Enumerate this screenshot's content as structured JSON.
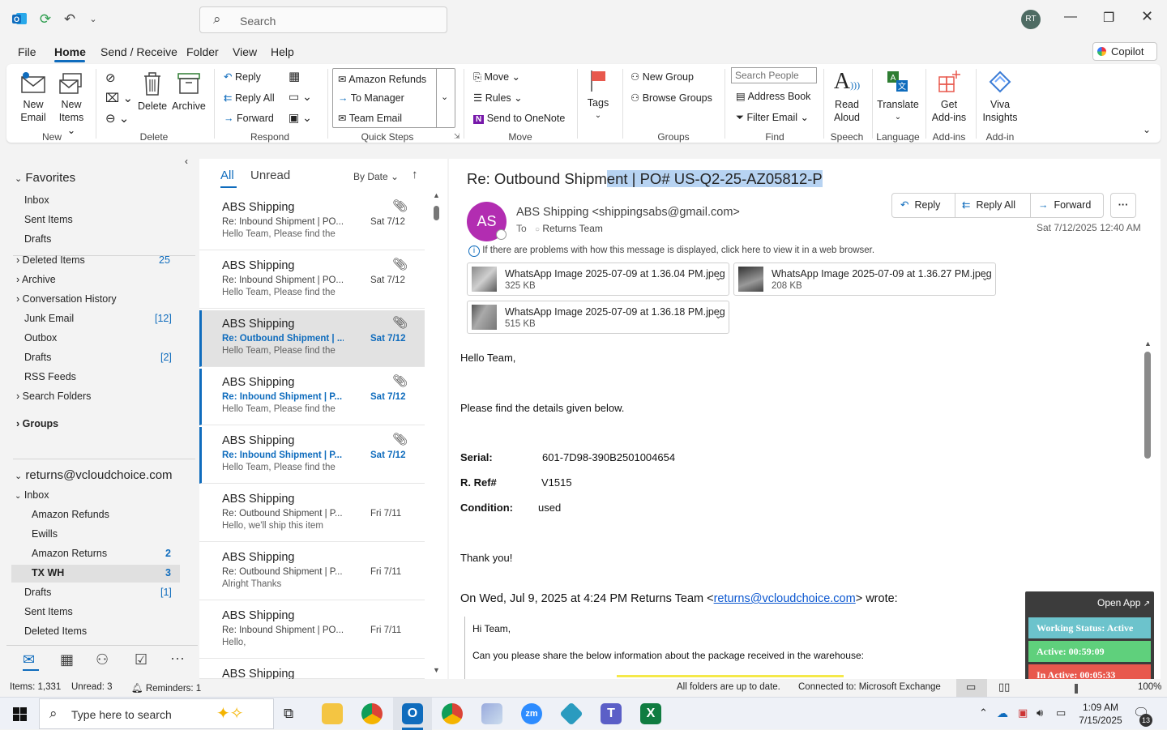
{
  "titlebar": {
    "search_placeholder": "Search",
    "avatar_initials": "RT"
  },
  "menu": {
    "file": "File",
    "home": "Home",
    "send_receive": "Send / Receive",
    "folder": "Folder",
    "view": "View",
    "help": "Help",
    "copilot": "Copilot"
  },
  "ribbon": {
    "new_email": "New Email",
    "new_items": "New Items",
    "group_new": "New",
    "delete": "Delete",
    "archive": "Archive",
    "group_delete": "Delete",
    "reply": "Reply",
    "reply_all": "Reply All",
    "forward": "Forward",
    "group_respond": "Respond",
    "qs_amazon_refunds": "Amazon Refunds",
    "qs_to_manager": "To Manager",
    "qs_team_email": "Team Email",
    "group_quick_steps": "Quick Steps",
    "move": "Move",
    "rules": "Rules",
    "send_to_onenote": "Send to OneNote",
    "group_move": "Move",
    "tags": "Tags",
    "new_group": "New Group",
    "browse_groups": "Browse Groups",
    "group_groups": "Groups",
    "search_people_placeholder": "Search People",
    "address_book": "Address Book",
    "filter_email": "Filter Email",
    "group_find": "Find",
    "read_aloud": "Read Aloud",
    "group_speech": "Speech",
    "translate": "Translate",
    "group_language": "Language",
    "get_addins": "Get Add-ins",
    "group_addins": "Add-ins",
    "viva_insights": "Viva Insights",
    "group_addin": "Add-in"
  },
  "nav": {
    "favorites": "Favorites",
    "fav_inbox": "Inbox",
    "fav_sent": "Sent Items",
    "fav_drafts": "Drafts",
    "deleted_items": "Deleted Items",
    "deleted_count": "25",
    "archive": "Archive",
    "conversation_history": "Conversation History",
    "junk_email": "Junk Email",
    "junk_count": "[12]",
    "outbox": "Outbox",
    "drafts": "Drafts",
    "drafts_count": "[2]",
    "rss_feeds": "RSS Feeds",
    "search_folders": "Search Folders",
    "groups": "Groups",
    "account": "returns@vcloudchoice.com",
    "inbox": "Inbox",
    "amazon_refunds": "Amazon Refunds",
    "ewills": "Ewills",
    "amazon_returns": "Amazon Returns",
    "amazon_returns_count": "2",
    "tx_wh": "TX WH",
    "tx_wh_count": "3",
    "acct_drafts": "Drafts",
    "acct_drafts_count": "[1]",
    "acct_sent": "Sent Items",
    "acct_deleted": "Deleted Items"
  },
  "list": {
    "tab_all": "All",
    "tab_unread": "Unread",
    "sort": "By Date",
    "items": [
      {
        "from": "ABS Shipping",
        "subject": "Re: Inbound Shipment | PO...",
        "preview": "Hello Team,  Please find the",
        "date": "Sat 7/12"
      },
      {
        "from": "ABS Shipping",
        "subject": "Re: Inbound Shipment | PO...",
        "preview": "Hello Team,  Please find the",
        "date": "Sat 7/12"
      },
      {
        "from": "ABS Shipping",
        "subject": "Re: Outbound Shipment | ...",
        "preview": "Hello Team,  Please find the",
        "date": "Sat 7/12"
      },
      {
        "from": "ABS Shipping",
        "subject": "Re: Inbound Shipment | P...",
        "preview": "Hello Team,  Please find the",
        "date": "Sat 7/12"
      },
      {
        "from": "ABS Shipping",
        "subject": "Re: Inbound Shipment | P...",
        "preview": "Hello Team,  Please find the",
        "date": "Sat 7/12"
      },
      {
        "from": "ABS Shipping",
        "subject": "Re: Outbound Shipment | P...",
        "preview": "Hello,  we'll ship this item",
        "date": "Fri 7/11"
      },
      {
        "from": "ABS Shipping",
        "subject": "Re: Outbound Shipment | P...",
        "preview": "Alright  Thanks",
        "date": "Fri 7/11"
      },
      {
        "from": "ABS Shipping",
        "subject": "Re: Inbound Shipment | PO...",
        "preview": "Hello,",
        "date": "Fri 7/11"
      },
      {
        "from": "ABS Shipping",
        "subject": "",
        "preview": "",
        "date": ""
      }
    ]
  },
  "message": {
    "subject_plain": "Re: Outbound Shipm",
    "subject_selected": "ent | PO# US-Q2-25-AZ05812-P",
    "sender_initials": "AS",
    "sender": "ABS Shipping <shippingsabs@gmail.com>",
    "to_label": "To",
    "to": "Returns Team",
    "date": "Sat 7/12/2025 12:40 AM",
    "reply": "Reply",
    "reply_all": "Reply All",
    "forward": "Forward",
    "info_bar": "If there are problems with how this message is displayed, click here to view it in a web browser.",
    "attachments": [
      {
        "name": "WhatsApp Image 2025-07-09 at 1.36.04 PM.jpeg",
        "size": "325 KB"
      },
      {
        "name": "WhatsApp Image 2025-07-09 at 1.36.27 PM.jpeg",
        "size": "208 KB"
      },
      {
        "name": "WhatsApp Image 2025-07-09 at 1.36.18 PM.jpeg",
        "size": "515 KB"
      }
    ],
    "greeting": "Hello Team,",
    "intro": "Please find the details given below.",
    "serial_label": "Serial:",
    "serial_value": "601-7D98-390B2501004654",
    "ref_label": "R. Ref#",
    "ref_value": "V1515",
    "condition_label": "Condition:",
    "condition_value": "used",
    "thanks": "Thank you!",
    "quote_prefix": "On Wed, Jul 9, 2025 at 4:24 PM Returns Team <",
    "quote_email": "returns@vcloudchoice.com",
    "quote_suffix": "> wrote:",
    "quote_hi": "Hi Team,",
    "quote_body": "Can you please share the below information about the package received in the warehouse:"
  },
  "widget": {
    "open_app": "Open App",
    "working_status": "Working Status: Active",
    "active": "Active: 00:59:09",
    "inactive": "In Active: 00:05:33",
    "colors": {
      "status": "#6cc3cc",
      "active": "#5fd07c",
      "inactive": "#e8584d"
    }
  },
  "status": {
    "items": "Items: 1,331",
    "unread": "Unread: 3",
    "reminders": "Reminders: 1",
    "folders": "All folders are up to date.",
    "connected": "Connected to: Microsoft Exchange",
    "zoom": "100%"
  },
  "taskbar": {
    "search_placeholder": "Type here to search",
    "time": "1:09 AM",
    "date": "7/15/2025",
    "notif_count": "13"
  }
}
